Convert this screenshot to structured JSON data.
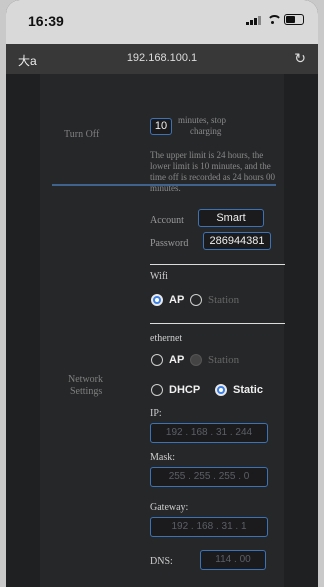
{
  "status_bar": {
    "time": "16:39",
    "signal_icon": "cellular-signal-icon",
    "wifi_icon": "wifi-icon",
    "battery_icon": "battery-icon"
  },
  "browser": {
    "aa_label": "大a",
    "url": "192.168.100.1",
    "reload_icon": "reload-icon"
  },
  "turn_off": {
    "label": "Turn Off",
    "minutes_value": "10",
    "desc_line1": "minutes, stop",
    "desc_line2": "charging",
    "note_line1": "The upper limit is 24 hours, the",
    "note_line2": "lower limit is 10 minutes, and the",
    "note_line3": "time off is recorded as 24 hours 00",
    "note_line4": "minutes."
  },
  "network": {
    "section_label_line1": "Network",
    "section_label_line2": "Settings",
    "account_label": "Account",
    "account_value": "Smart",
    "password_label": "Password",
    "password_value": "286944381",
    "wifi": {
      "title": "Wifi",
      "ap_label": "AP",
      "station_label": "Station",
      "selected": "AP"
    },
    "ethernet": {
      "title": "ethernet",
      "ap_label": "AP",
      "station_label": "Station",
      "dhcp_label": "DHCP",
      "static_label": "Static",
      "selected_mode": "AP",
      "selected_addressing": "Static"
    },
    "ip_label": "IP:",
    "ip_value": "192 . 168 . 31 . 244",
    "mask_label": "Mask:",
    "mask_value": "255 . 255 . 255 . 0",
    "gateway_label": "Gateway:",
    "gateway_value": "192 . 168 . 31 . 1",
    "dns_label": "DNS:",
    "dns_value": "114 . 00"
  },
  "colors": {
    "accent": "#3c7fe5",
    "field_border": "#3d73b6",
    "panel_bg": "#262729",
    "divider_blue": "#3f638e"
  }
}
